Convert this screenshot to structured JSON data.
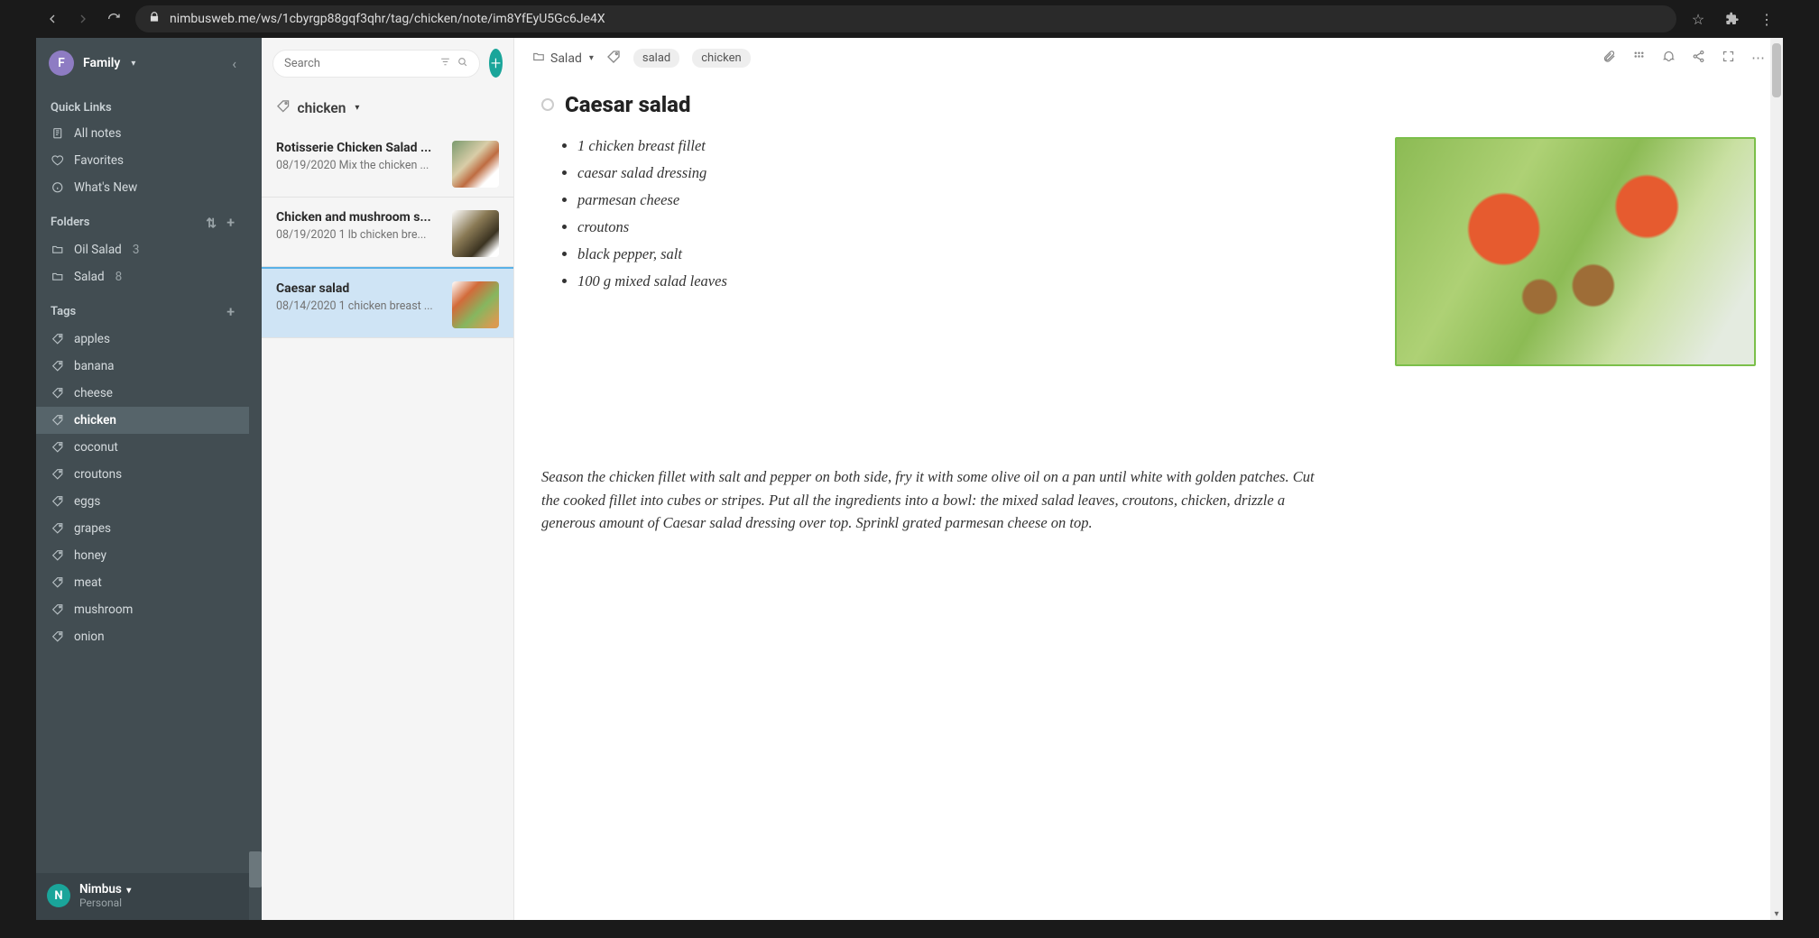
{
  "browser": {
    "url": "nimbusweb.me/ws/1cbyrgp88gqf3qhr/tag/chicken/note/im8YfEyU5Gc6Je4X"
  },
  "workspace": {
    "badge": "F",
    "name": "Family"
  },
  "quicklinks": {
    "label": "Quick Links",
    "all_notes": "All notes",
    "favorites": "Favorites",
    "whats_new": "What's New"
  },
  "folders": {
    "label": "Folders",
    "items": [
      {
        "name": "Oil Salad",
        "count": "3"
      },
      {
        "name": "Salad",
        "count": "8"
      }
    ]
  },
  "tags": {
    "label": "Tags",
    "items": [
      "apples",
      "banana",
      "cheese",
      "chicken",
      "coconut",
      "croutons",
      "eggs",
      "grapes",
      "honey",
      "meat",
      "mushroom",
      "onion"
    ],
    "active": "chicken"
  },
  "account": {
    "badge": "N",
    "name": "Nimbus",
    "plan": "Personal"
  },
  "search": {
    "placeholder": "Search"
  },
  "tag_filter": {
    "name": "chicken"
  },
  "notes": [
    {
      "title": "Rotisserie Chicken Salad ...",
      "date": "08/19/2020",
      "excerpt": "Mix the chicken ..."
    },
    {
      "title": "Chicken and mushroom s...",
      "date": "08/19/2020",
      "excerpt": "1 lb chicken bre..."
    },
    {
      "title": "Caesar salad",
      "date": "08/14/2020",
      "excerpt": "1 chicken breast ..."
    }
  ],
  "crumb": {
    "folder": "Salad",
    "tags": [
      "salad",
      "chicken"
    ]
  },
  "note": {
    "title": "Caesar salad",
    "ingredients": [
      "1 chicken breast fillet",
      "caesar salad dressing",
      "parmesan cheese",
      "croutons",
      "black pepper, salt",
      "100 g mixed salad leaves"
    ],
    "instructions": "Season the chicken fillet with salt and pepper on both side, fry it with some olive oil on a pan until white with golden patches. Cut the cooked fillet into cubes or stripes. Put all the ingredients into a bowl: the mixed salad leaves, croutons, chicken, drizzle a generous amount of Caesar salad dressing over top. Sprinkl grated parmesan cheese on top."
  }
}
